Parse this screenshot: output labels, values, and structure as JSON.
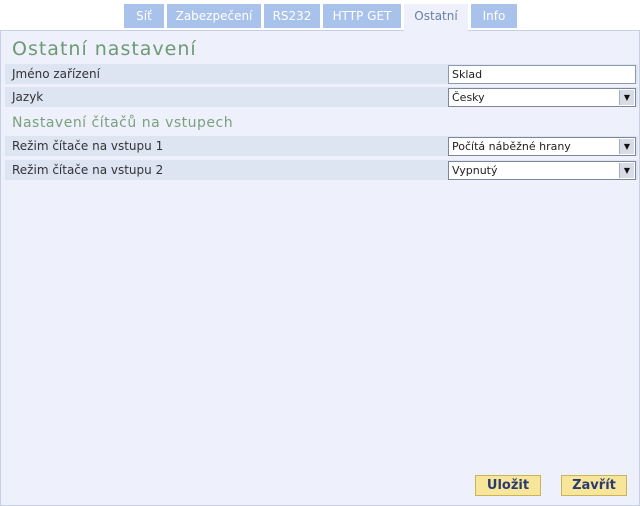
{
  "tabs": [
    {
      "label": "Síť"
    },
    {
      "label": "Zabezpečení"
    },
    {
      "label": "RS232"
    },
    {
      "label": "HTTP GET"
    },
    {
      "label": "Ostatní"
    },
    {
      "label": "Info"
    }
  ],
  "active_tab": "Ostatní",
  "main": {
    "title": "Ostatní nastavení",
    "device_name_label": "Jméno zařízení",
    "device_name_value": "Sklad",
    "language_label": "Jazyk",
    "language_value": "Česky",
    "counters_title": "Nastavení čítačů na vstupech",
    "counter1_label": "Režim čítače na vstupu 1",
    "counter1_value": "Počítá náběžné hrany",
    "counter2_label": "Režim čítače na vstupu 2",
    "counter2_value": "Vypnutý"
  },
  "buttons": {
    "save_label": "Uložit",
    "close_label": "Zavřít"
  },
  "icons": {
    "select_arrow": "chevron-down-icon"
  },
  "colors": {
    "tab_bg": "#a9c2ec",
    "panel_bg": "#eef0fb",
    "row_bg": "#dde4f2",
    "heading": "#6e9a73",
    "button_bg": "#f7e69a",
    "button_text": "#2a3b70"
  }
}
